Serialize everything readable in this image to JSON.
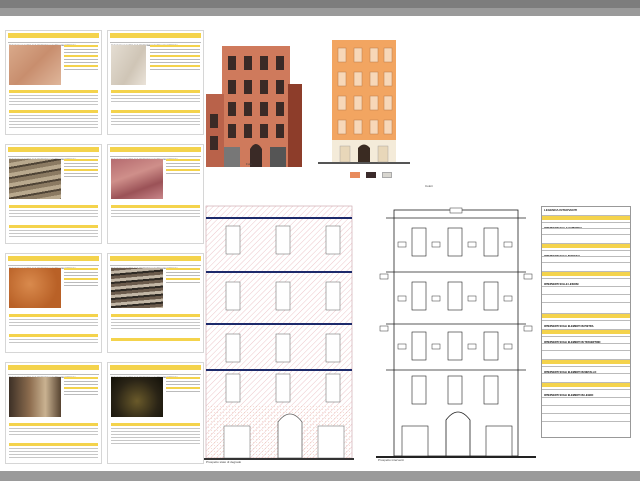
{
  "document": {
    "cards": [
      {
        "title": "ANALISI DELLE FORME DI ALTERAZIONE E DEGRADO DEI MATERIALI",
        "label": "DEPOSITO SUPERFICIALE"
      },
      {
        "title": "ANALISI DELLE FORME DI ALTERAZIONE E DEGRADO DEI MATERIALI",
        "label": "CROSTA"
      },
      {
        "title": "ANALISI DELLE FORME DI ALTERAZIONE E DEGRADO DEI MATERIALI",
        "label": "FRATTURAZIONE"
      },
      {
        "title": "ANALISI DELLE FORME DI ALTERAZIONE E DEGRADO DEI MATERIALI",
        "label": "MACCHIA"
      },
      {
        "title": "ANALISI DELLE FORME DI ALTERAZIONE E DEGRADO DEI MATERIALI",
        "label": "PATINA BIOLOGICA"
      },
      {
        "title": "ANALISI DELLE FORME DI ALTERAZIONE E DEGRADO DEI MATERIALI",
        "label": "ALVEOLIZZAZIONE"
      },
      {
        "title": "ANALISI DELLE FORME DI ALTERAZIONE E DEGRADO DEI MATERIALI",
        "label": "DISTACCO"
      },
      {
        "title": "ANALISI DELLE FORME DI ALTERAZIONE E DEGRADO DEI MATERIALI",
        "label": "EFFLORESCENZA"
      }
    ],
    "captions": {
      "photo": "Foto",
      "color": "Colori",
      "degrado": "Prospetto stato di degrado",
      "interventi": "Prospetto interventi"
    },
    "legend": {
      "title": "LEGENDA INTERVENTI",
      "rows": [
        "INTERVENTI SULLE SUPERFICI",
        "INTERVENTI SUGLI INTONACI",
        "INTERVENTI SULLE LESIONI",
        "INTERVENTI SUGLI ELEMENTI IN PIETRA",
        "INTERVENTI SUGLI ELEMENTI IN TRAVERTINO",
        "INTERVENTI SUGLI ELEMENTI IN METALLO",
        "INTERVENTI SUGLI ELEMENTI IN LEGNO"
      ]
    },
    "swatch_colors": [
      "#e88b5c",
      "#3b2b2b",
      "#d8d6d0"
    ],
    "facade_color": "#f0a661"
  }
}
